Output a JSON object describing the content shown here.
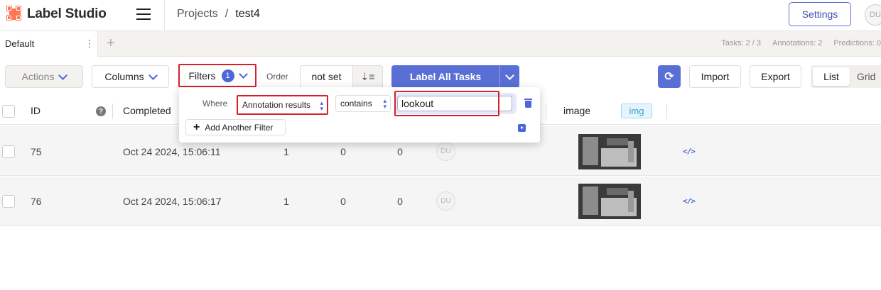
{
  "app": {
    "name": "Label Studio"
  },
  "breadcrumb": {
    "projects": "Projects",
    "separator": "/",
    "current": "test4"
  },
  "header": {
    "settings_label": "Settings",
    "avatar_initials": "DU"
  },
  "tabs": {
    "items": [
      {
        "label": "Default"
      }
    ],
    "menu_glyph": "⋮",
    "add_glyph": "+"
  },
  "stats": {
    "tasks": "Tasks: 2 / 3",
    "annotations": "Annotations: 2",
    "predictions": "Predictions: 0"
  },
  "toolbar": {
    "actions_label": "Actions",
    "columns_label": "Columns",
    "filters_label": "Filters",
    "filters_count": "1",
    "order_label": "Order",
    "order_value": "not set",
    "label_all_label": "Label All Tasks",
    "import_label": "Import",
    "export_label": "Export",
    "view_list_label": "List",
    "view_grid_label": "Grid"
  },
  "filter": {
    "where_label": "Where",
    "field": "Annotation results",
    "operator": "contains",
    "value": "lookout",
    "add_label": "Add Another Filter"
  },
  "columns": {
    "id": "ID",
    "help": "?",
    "completed": "Completed",
    "image": "image",
    "image_type": "img"
  },
  "rows": [
    {
      "id": "75",
      "completed": "Oct 24 2024, 15:06:11",
      "annotations": "1",
      "cancelled": "0",
      "predictions": "0",
      "avatar": "DU",
      "data_icon": "</>"
    },
    {
      "id": "76",
      "completed": "Oct 24 2024, 15:06:17",
      "annotations": "1",
      "cancelled": "0",
      "predictions": "0",
      "avatar": "DU",
      "data_icon": "</>"
    }
  ],
  "colors": {
    "accent": "#5a6fd6",
    "highlight": "#d8202b",
    "logo": "#ff7557"
  }
}
